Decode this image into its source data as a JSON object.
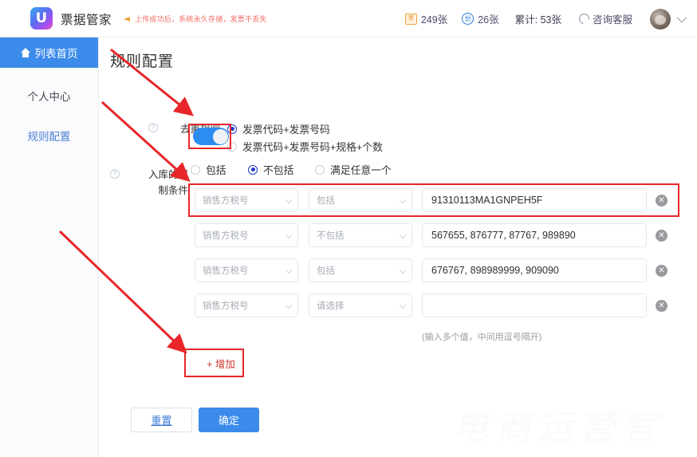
{
  "header": {
    "brand": "票据管家",
    "logo_glyph": "U",
    "announcement": "上传成功后，系统永久存储，发票不丢失",
    "announcement_icon": "megaphone-icon",
    "stats": [
      {
        "icon": "invoice-badge-icon",
        "icon_char": "票",
        "value": "249张"
      },
      {
        "icon": "circle-badge-icon",
        "icon_char": "份",
        "value": "26张"
      }
    ],
    "cumulative": "累计: 53张",
    "service_label": "咨询客服",
    "service_icon": "headset-icon",
    "avatar_caret": "chevron-down-icon"
  },
  "sidebar": {
    "items": [
      {
        "label": "列表首页",
        "icon": "home-icon",
        "active": true
      },
      {
        "label": "个人中心",
        "icon": "",
        "active": false
      },
      {
        "label": "规则配置",
        "icon": "",
        "active": false
      }
    ]
  },
  "main": {
    "title": "规则配置",
    "dedupe": {
      "label": "去重规则",
      "help_icon": "question-mark-icon",
      "options": [
        {
          "label": "发票代码+发票号码",
          "checked": true
        },
        {
          "label": "发票代码+发票号码+规格+个数",
          "checked": false
        }
      ]
    },
    "limit": {
      "label_line1": "入库的限",
      "label_line2": "制条件",
      "help_icon": "question-mark-icon",
      "toggle_on": true,
      "match_options": [
        {
          "label": "包括",
          "checked": false
        },
        {
          "label": "不包括",
          "checked": true
        },
        {
          "label": "满足任意一个",
          "checked": false
        }
      ]
    },
    "condition_rows": [
      {
        "field": "销售方税号",
        "operator": "包括",
        "value": "91310113MA1GNPEH5F",
        "delete_icon": "close-circle-icon"
      },
      {
        "field": "销售方税号",
        "operator": "不包括",
        "value": "567655, 876777, 87767, 989890",
        "delete_icon": "close-circle-icon"
      },
      {
        "field": "销售方税号",
        "operator": "包括",
        "value": "676767, 898989999, 909090",
        "delete_icon": "close-circle-icon"
      },
      {
        "field": "销售方税号",
        "operator": "请选择",
        "value": "",
        "delete_icon": "close-circle-icon"
      }
    ],
    "value_hint": "(输入多个值，中间用逗号隔开)",
    "add_button": "+ 增加",
    "reset_button": "重置",
    "confirm_button": "确定"
  },
  "watermark": "电商运营官",
  "colors": {
    "primary_blue": "#3b8bea",
    "toggle_blue": "#2d8cf0",
    "radio_checked": "#1e39c8",
    "annotation_red": "#e8262a",
    "link_blue": "#4c7fd6",
    "announce_red": "#f06c64"
  }
}
